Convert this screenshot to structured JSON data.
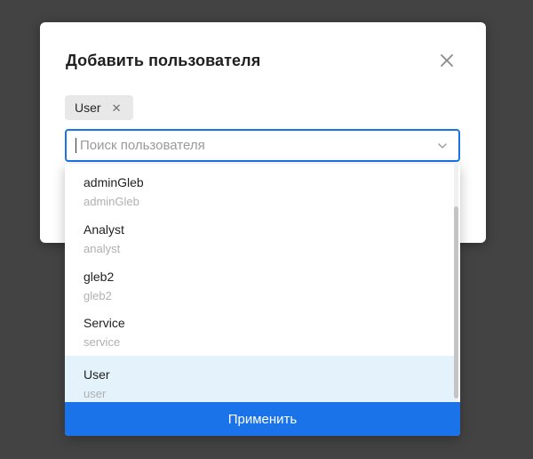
{
  "modal": {
    "title": "Добавить пользователя"
  },
  "chip": {
    "label": "User",
    "remove_symbol": "✕"
  },
  "search": {
    "value": "",
    "placeholder": "Поиск пользователя"
  },
  "dropdown": {
    "items": [
      {
        "name": "adminGleb",
        "sub": "adminGleb"
      },
      {
        "name": "Analyst",
        "sub": "analyst"
      },
      {
        "name": "gleb2",
        "sub": "gleb2"
      },
      {
        "name": "Service",
        "sub": "service"
      },
      {
        "name": "User",
        "sub": "user"
      }
    ],
    "selected_item": "User",
    "apply_label": "Применить"
  },
  "icons": {
    "close": "close-icon",
    "chevron": "chevron-down-icon",
    "chip_remove": "close-icon"
  },
  "colors": {
    "accent": "#1a73e8",
    "selected_bg": "#e4f2fb",
    "backdrop": "#434343"
  }
}
